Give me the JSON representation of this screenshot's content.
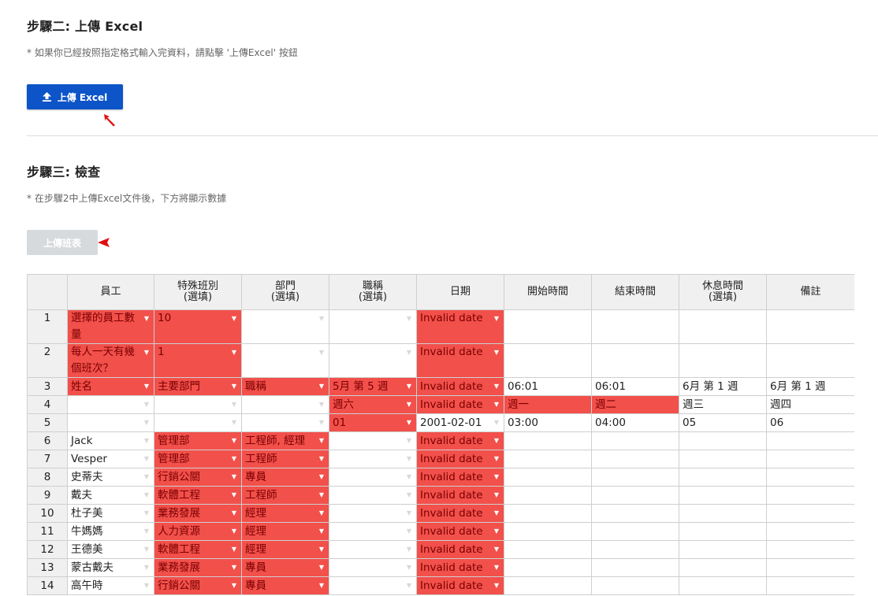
{
  "step2": {
    "title": "步驟二: 上傳 Excel",
    "note": "* 如果你已經按照指定格式輸入完資料，請點擊 '上傳Excel' 按鈕",
    "button_label": "上傳 Excel",
    "button_icon": "upload-icon"
  },
  "step3": {
    "title": "步驟三: 檢查",
    "note": "* 在步驟2中上傳Excel文件後，下方將顯示數據",
    "button_label": "上傳班表"
  },
  "colors": {
    "primary": "#0d54c9",
    "error_cell": "#f2504b",
    "disabled": "#d7dadd",
    "pointer": "#e01010"
  },
  "grid": {
    "headers": [
      "",
      "員工",
      "特殊班別\n(選填)",
      "部門\n(選填)",
      "職稱\n(選填)",
      "日期",
      "開始時間",
      "結束時間",
      "休息時間\n(選填)",
      "備註"
    ],
    "rows": [
      {
        "num": "1",
        "cells": [
          {
            "t": "選擇的員工數量",
            "e": 1,
            "d": 1
          },
          {
            "t": "10",
            "e": 1,
            "d": 1
          },
          {
            "t": "",
            "e": 0,
            "d": 1
          },
          {
            "t": "",
            "e": 0,
            "d": 1
          },
          {
            "t": "Invalid date",
            "e": 1,
            "d": 1
          },
          {
            "t": ""
          },
          {
            "t": ""
          },
          {
            "t": ""
          },
          {
            "t": ""
          }
        ]
      },
      {
        "num": "2",
        "cells": [
          {
            "t": "每人一天有幾個班次？",
            "e": 1,
            "d": 1
          },
          {
            "t": "1",
            "e": 1,
            "d": 1
          },
          {
            "t": "",
            "e": 0,
            "d": 1
          },
          {
            "t": "",
            "e": 0,
            "d": 1
          },
          {
            "t": "Invalid date",
            "e": 1,
            "d": 1
          },
          {
            "t": ""
          },
          {
            "t": ""
          },
          {
            "t": ""
          },
          {
            "t": ""
          }
        ]
      },
      {
        "num": "3",
        "cells": [
          {
            "t": "姓名",
            "e": 1,
            "d": 1
          },
          {
            "t": "主要部門",
            "e": 1,
            "d": 1
          },
          {
            "t": "職稱",
            "e": 1,
            "d": 1
          },
          {
            "t": "5月 第 5 週",
            "e": 1,
            "d": 1
          },
          {
            "t": "Invalid date",
            "e": 1,
            "d": 1
          },
          {
            "t": "06:01"
          },
          {
            "t": "06:01"
          },
          {
            "t": "6月 第 1 週"
          },
          {
            "t": "6月 第 1 週"
          }
        ]
      },
      {
        "num": "4",
        "cells": [
          {
            "t": "",
            "e": 0,
            "d": 1
          },
          {
            "t": "",
            "e": 0,
            "d": 1
          },
          {
            "t": "",
            "e": 0,
            "d": 1
          },
          {
            "t": "週六",
            "e": 1,
            "d": 1
          },
          {
            "t": "Invalid date",
            "e": 1,
            "d": 1
          },
          {
            "t": "週一",
            "e": 1
          },
          {
            "t": "週二",
            "e": 1
          },
          {
            "t": "週三"
          },
          {
            "t": "週四"
          }
        ]
      },
      {
        "num": "5",
        "cells": [
          {
            "t": "",
            "e": 0,
            "d": 1
          },
          {
            "t": "",
            "e": 0,
            "d": 1
          },
          {
            "t": "",
            "e": 0,
            "d": 1
          },
          {
            "t": "01",
            "e": 1,
            "d": 1
          },
          {
            "t": "2001-02-01",
            "e": 0,
            "d": 1
          },
          {
            "t": "03:00"
          },
          {
            "t": "04:00"
          },
          {
            "t": "05"
          },
          {
            "t": "06"
          }
        ]
      },
      {
        "num": "6",
        "cells": [
          {
            "t": "Jack",
            "e": 0,
            "d": 1
          },
          {
            "t": "管理部",
            "e": 1,
            "d": 1
          },
          {
            "t": "工程師, 經理",
            "e": 1,
            "d": 1
          },
          {
            "t": "",
            "e": 0,
            "d": 1
          },
          {
            "t": "Invalid date",
            "e": 1,
            "d": 1
          },
          {
            "t": ""
          },
          {
            "t": ""
          },
          {
            "t": ""
          },
          {
            "t": ""
          }
        ]
      },
      {
        "num": "7",
        "cells": [
          {
            "t": "Vesper",
            "e": 0,
            "d": 1
          },
          {
            "t": "管理部",
            "e": 1,
            "d": 1
          },
          {
            "t": "工程師",
            "e": 1,
            "d": 1
          },
          {
            "t": "",
            "e": 0,
            "d": 1
          },
          {
            "t": "Invalid date",
            "e": 1,
            "d": 1
          },
          {
            "t": ""
          },
          {
            "t": ""
          },
          {
            "t": ""
          },
          {
            "t": ""
          }
        ]
      },
      {
        "num": "8",
        "cells": [
          {
            "t": "史蒂夫",
            "e": 0,
            "d": 1
          },
          {
            "t": "行銷公關",
            "e": 1,
            "d": 1
          },
          {
            "t": "專員",
            "e": 1,
            "d": 1
          },
          {
            "t": "",
            "e": 0,
            "d": 1
          },
          {
            "t": "Invalid date",
            "e": 1,
            "d": 1
          },
          {
            "t": ""
          },
          {
            "t": ""
          },
          {
            "t": ""
          },
          {
            "t": ""
          }
        ]
      },
      {
        "num": "9",
        "cells": [
          {
            "t": "戴夫",
            "e": 0,
            "d": 1
          },
          {
            "t": "軟體工程",
            "e": 1,
            "d": 1
          },
          {
            "t": "工程師",
            "e": 1,
            "d": 1
          },
          {
            "t": "",
            "e": 0,
            "d": 1
          },
          {
            "t": "Invalid date",
            "e": 1,
            "d": 1
          },
          {
            "t": ""
          },
          {
            "t": ""
          },
          {
            "t": ""
          },
          {
            "t": ""
          }
        ]
      },
      {
        "num": "10",
        "cells": [
          {
            "t": "杜子美",
            "e": 0,
            "d": 1
          },
          {
            "t": "業務發展",
            "e": 1,
            "d": 1
          },
          {
            "t": "經理",
            "e": 1,
            "d": 1
          },
          {
            "t": "",
            "e": 0,
            "d": 1
          },
          {
            "t": "Invalid date",
            "e": 1,
            "d": 1
          },
          {
            "t": ""
          },
          {
            "t": ""
          },
          {
            "t": ""
          },
          {
            "t": ""
          }
        ]
      },
      {
        "num": "11",
        "cells": [
          {
            "t": "牛媽媽",
            "e": 0,
            "d": 1
          },
          {
            "t": "人力資源",
            "e": 1,
            "d": 1
          },
          {
            "t": "經理",
            "e": 1,
            "d": 1
          },
          {
            "t": "",
            "e": 0,
            "d": 1
          },
          {
            "t": "Invalid date",
            "e": 1,
            "d": 1
          },
          {
            "t": ""
          },
          {
            "t": ""
          },
          {
            "t": ""
          },
          {
            "t": ""
          }
        ]
      },
      {
        "num": "12",
        "cells": [
          {
            "t": "王德美",
            "e": 0,
            "d": 1
          },
          {
            "t": "軟體工程",
            "e": 1,
            "d": 1
          },
          {
            "t": "經理",
            "e": 1,
            "d": 1
          },
          {
            "t": "",
            "e": 0,
            "d": 1
          },
          {
            "t": "Invalid date",
            "e": 1,
            "d": 1
          },
          {
            "t": ""
          },
          {
            "t": ""
          },
          {
            "t": ""
          },
          {
            "t": ""
          }
        ]
      },
      {
        "num": "13",
        "cells": [
          {
            "t": "蒙古戴夫",
            "e": 0,
            "d": 1
          },
          {
            "t": "業務發展",
            "e": 1,
            "d": 1
          },
          {
            "t": "專員",
            "e": 1,
            "d": 1
          },
          {
            "t": "",
            "e": 0,
            "d": 1
          },
          {
            "t": "Invalid date",
            "e": 1,
            "d": 1
          },
          {
            "t": ""
          },
          {
            "t": ""
          },
          {
            "t": ""
          },
          {
            "t": ""
          }
        ]
      },
      {
        "num": "14",
        "cells": [
          {
            "t": "高午時",
            "e": 0,
            "d": 1
          },
          {
            "t": "行銷公關",
            "e": 1,
            "d": 1
          },
          {
            "t": "專員",
            "e": 1,
            "d": 1
          },
          {
            "t": "",
            "e": 0,
            "d": 1
          },
          {
            "t": "Invalid date",
            "e": 1,
            "d": 1
          },
          {
            "t": ""
          },
          {
            "t": ""
          },
          {
            "t": ""
          },
          {
            "t": ""
          }
        ]
      }
    ]
  }
}
